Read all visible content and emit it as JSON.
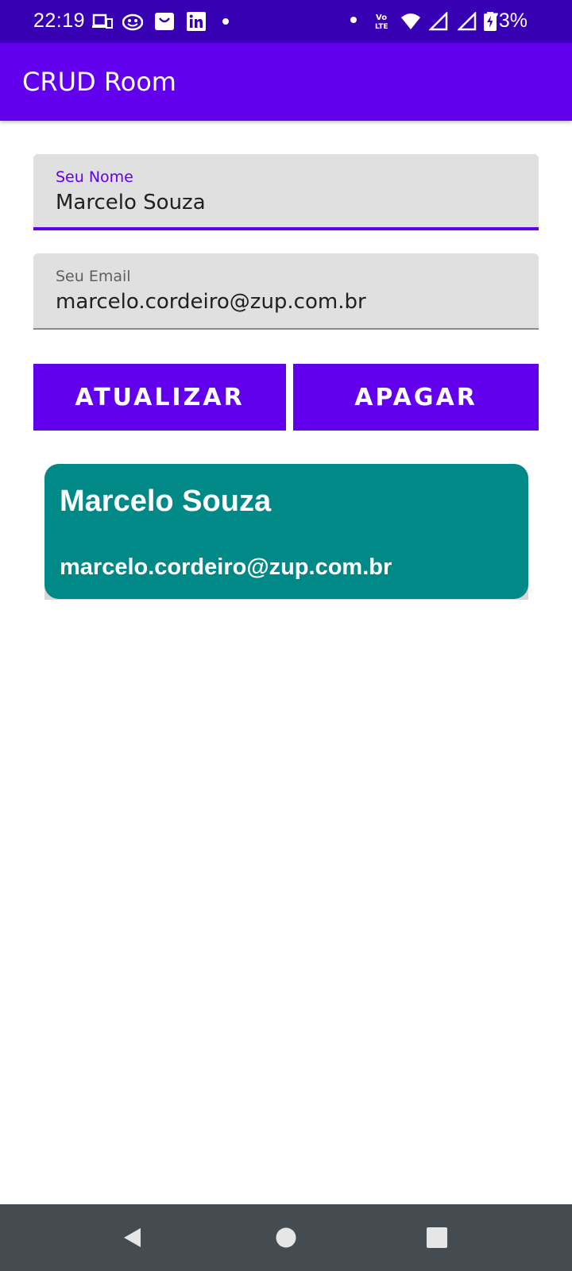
{
  "status_bar": {
    "time": "22:19",
    "battery": "73%",
    "left_icons": [
      "devices-icon",
      "smiley-app-icon",
      "shopping-bag-icon",
      "linkedin-icon",
      "dot-icon"
    ],
    "right_icons": [
      "dot-icon",
      "volte-icon",
      "wifi-icon",
      "signal-icon",
      "signal-icon",
      "battery-icon"
    ]
  },
  "app_bar": {
    "title": "CRUD Room"
  },
  "form": {
    "name": {
      "label": "Seu Nome",
      "value": "Marcelo Souza"
    },
    "email": {
      "label": "Seu Email",
      "value": "marcelo.cordeiro@zup.com.br"
    }
  },
  "buttons": {
    "update": "ATUALIZAR",
    "delete": "APAGAR"
  },
  "list": {
    "items": [
      {
        "name": "Marcelo Souza",
        "email": "marcelo.cordeiro@zup.com.br"
      }
    ]
  },
  "nav_bar": {
    "icons": [
      "back-icon",
      "home-icon",
      "recents-icon"
    ]
  },
  "colors": {
    "status_bar": "#3700b3",
    "primary": "#6200ee",
    "card": "#008987",
    "nav_bar": "#454c51"
  }
}
